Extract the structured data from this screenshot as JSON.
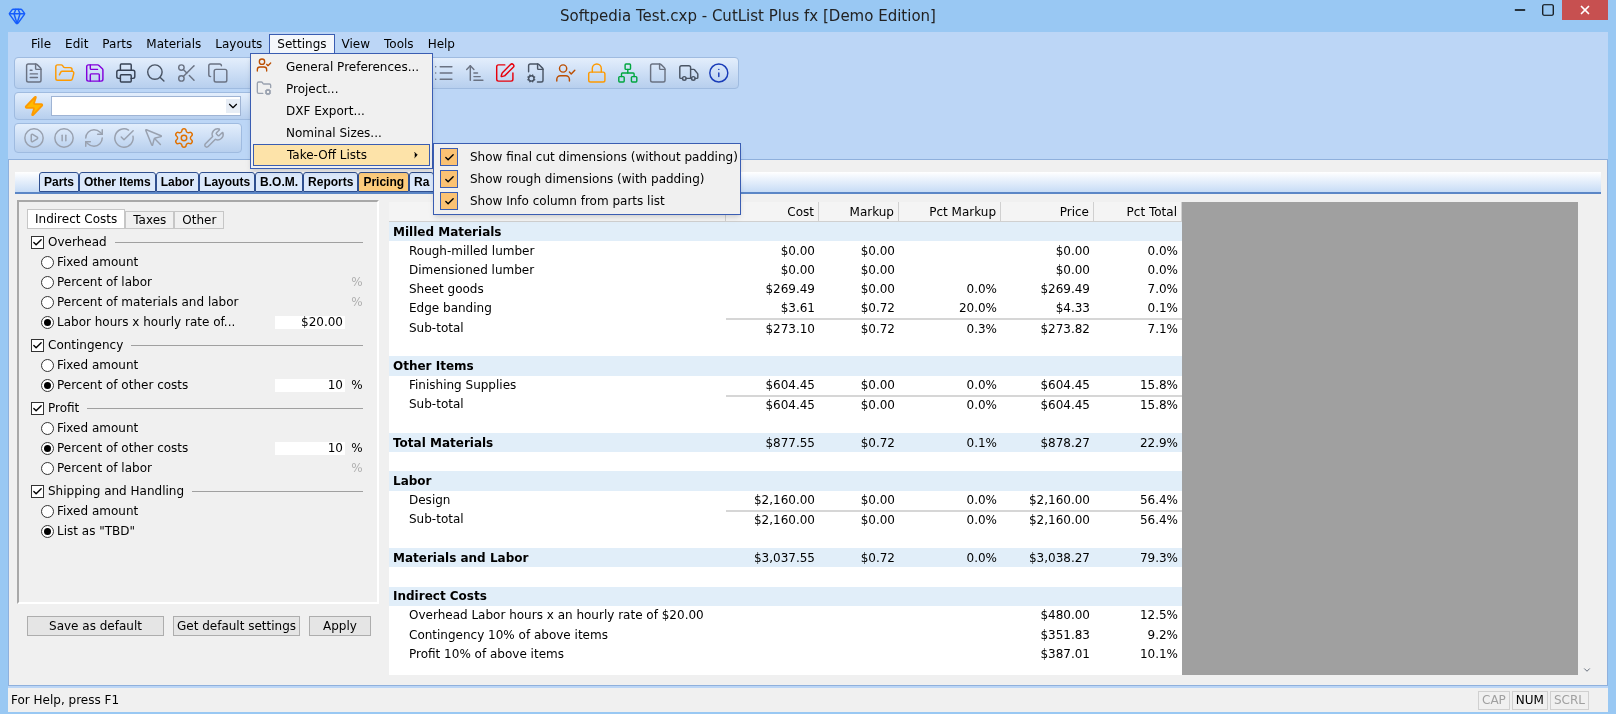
{
  "window": {
    "title": "Softpedia Test.cxp - CutList Plus fx [Demo Edition]"
  },
  "menu_bar": [
    {
      "label": "File",
      "selected": false
    },
    {
      "label": "Edit",
      "selected": false
    },
    {
      "label": "Parts",
      "selected": false
    },
    {
      "label": "Materials",
      "selected": false
    },
    {
      "label": "Layouts",
      "selected": false
    },
    {
      "label": "Settings",
      "selected": true
    },
    {
      "label": "View",
      "selected": false
    },
    {
      "label": "Tools",
      "selected": false
    },
    {
      "label": "Help",
      "selected": false
    }
  ],
  "settings_menu": [
    {
      "label": "General Preferences...",
      "selected": false,
      "has_submenu": false
    },
    {
      "label": "Project...",
      "selected": false,
      "has_submenu": false
    },
    {
      "label": "DXF Export...",
      "selected": false,
      "has_submenu": false
    },
    {
      "label": "Nominal Sizes...",
      "selected": false,
      "has_submenu": false
    },
    {
      "label": "Take-Off Lists",
      "selected": true,
      "has_submenu": true
    }
  ],
  "takeoff_submenu": [
    {
      "label": "Show final cut dimensions (without padding)",
      "checked": true
    },
    {
      "label": "Show rough dimensions (with padding)",
      "checked": true
    },
    {
      "label": "Show Info column from parts list",
      "checked": true
    }
  ],
  "tabs": [
    {
      "label": "Parts",
      "selected": false
    },
    {
      "label": "Other Items",
      "selected": false
    },
    {
      "label": "Labor",
      "selected": false
    },
    {
      "label": "Layouts",
      "selected": false
    },
    {
      "label": "B.O.M.",
      "selected": false
    },
    {
      "label": "Reports",
      "selected": false
    },
    {
      "label": "Pricing",
      "selected": true
    },
    {
      "label": "Ra",
      "selected": false
    }
  ],
  "settings_panel": {
    "tabs": [
      {
        "label": "Indirect Costs",
        "selected": true
      },
      {
        "label": "Taxes",
        "selected": false
      },
      {
        "label": "Other",
        "selected": false
      }
    ],
    "groups": [
      {
        "label": "Overhead",
        "checked": true,
        "options": [
          {
            "label": "Fixed amount",
            "selected": false
          },
          {
            "label": "Percent of labor",
            "selected": false,
            "unit": "%"
          },
          {
            "label": "Percent of materials and labor",
            "selected": false,
            "unit": "%"
          },
          {
            "label": "Labor hours x hourly rate of...",
            "selected": true,
            "value": "$20.00"
          }
        ]
      },
      {
        "label": "Contingency",
        "checked": true,
        "options": [
          {
            "label": "Fixed amount",
            "selected": false
          },
          {
            "label": "Percent of other costs",
            "selected": true,
            "value": "10",
            "unit": "%"
          }
        ]
      },
      {
        "label": "Profit",
        "checked": true,
        "options": [
          {
            "label": "Fixed amount",
            "selected": false
          },
          {
            "label": "Percent of other costs",
            "selected": true,
            "value": "10",
            "unit": "%"
          },
          {
            "label": "Percent of labor",
            "selected": false,
            "unit": "%"
          }
        ]
      },
      {
        "label": "Shipping and Handling",
        "checked": true,
        "options": [
          {
            "label": "Fixed amount",
            "selected": false
          },
          {
            "label": "List as \"TBD\"",
            "selected": true
          }
        ]
      }
    ],
    "buttons": [
      "Save as default",
      "Get default settings",
      "Apply"
    ]
  },
  "table": {
    "columns": [
      "Cost",
      "Markup",
      "Pct Markup",
      "Price",
      "Pct Total"
    ],
    "rows": [
      {
        "kind": "section",
        "label": "Milled Materials"
      },
      {
        "kind": "item",
        "label": "Rough-milled lumber",
        "cells": [
          "$0.00",
          "$0.00",
          "",
          "$0.00",
          "0.0%"
        ]
      },
      {
        "kind": "item",
        "label": "Dimensioned lumber",
        "cells": [
          "$0.00",
          "$0.00",
          "",
          "$0.00",
          "0.0%"
        ]
      },
      {
        "kind": "item",
        "label": "Sheet goods",
        "cells": [
          "$269.49",
          "$0.00",
          "0.0%",
          "$269.49",
          "7.0%"
        ]
      },
      {
        "kind": "item",
        "label": "Edge banding",
        "cells": [
          "$3.61",
          "$0.72",
          "20.0%",
          "$4.33",
          "0.1%"
        ]
      },
      {
        "kind": "subtotal",
        "label": "Sub-total",
        "cells": [
          "$273.10",
          "$0.72",
          "0.3%",
          "$273.82",
          "7.1%"
        ]
      },
      {
        "kind": "blank"
      },
      {
        "kind": "section",
        "label": "Other Items"
      },
      {
        "kind": "item",
        "label": "Finishing Supplies",
        "cells": [
          "$604.45",
          "$0.00",
          "0.0%",
          "$604.45",
          "15.8%"
        ]
      },
      {
        "kind": "subtotal",
        "label": "Sub-total",
        "cells": [
          "$604.45",
          "$0.00",
          "0.0%",
          "$604.45",
          "15.8%"
        ]
      },
      {
        "kind": "blank"
      },
      {
        "kind": "total",
        "label": "Total Materials",
        "cells": [
          "$877.55",
          "$0.72",
          "0.1%",
          "$878.27",
          "22.9%"
        ]
      },
      {
        "kind": "blank"
      },
      {
        "kind": "section",
        "label": "Labor"
      },
      {
        "kind": "item",
        "label": "Design",
        "cells": [
          "$2,160.00",
          "$0.00",
          "0.0%",
          "$2,160.00",
          "56.4%"
        ]
      },
      {
        "kind": "subtotal",
        "label": "Sub-total",
        "cells": [
          "$2,160.00",
          "$0.00",
          "0.0%",
          "$2,160.00",
          "56.4%"
        ]
      },
      {
        "kind": "blank"
      },
      {
        "kind": "total",
        "label": "Materials and Labor",
        "cells": [
          "$3,037.55",
          "$0.72",
          "0.0%",
          "$3,038.27",
          "79.3%"
        ]
      },
      {
        "kind": "blank"
      },
      {
        "kind": "section",
        "label": "Indirect Costs"
      },
      {
        "kind": "item",
        "label": "Overhead Labor hours x an hourly rate of $20.00",
        "cells": [
          "",
          "",
          "",
          "$480.00",
          "12.5%"
        ]
      },
      {
        "kind": "item",
        "label": "Contingency 10% of above items",
        "cells": [
          "",
          "",
          "",
          "$351.83",
          "9.2%"
        ]
      },
      {
        "kind": "item",
        "label": "Profit 10% of above items",
        "cells": [
          "",
          "",
          "",
          "$387.01",
          "10.1%"
        ]
      }
    ]
  },
  "status_bar": {
    "help_text": "For Help, press F1",
    "indicators": [
      {
        "label": "CAP",
        "on": false
      },
      {
        "label": "NUM",
        "on": true
      },
      {
        "label": "SCRL",
        "on": false
      }
    ]
  }
}
